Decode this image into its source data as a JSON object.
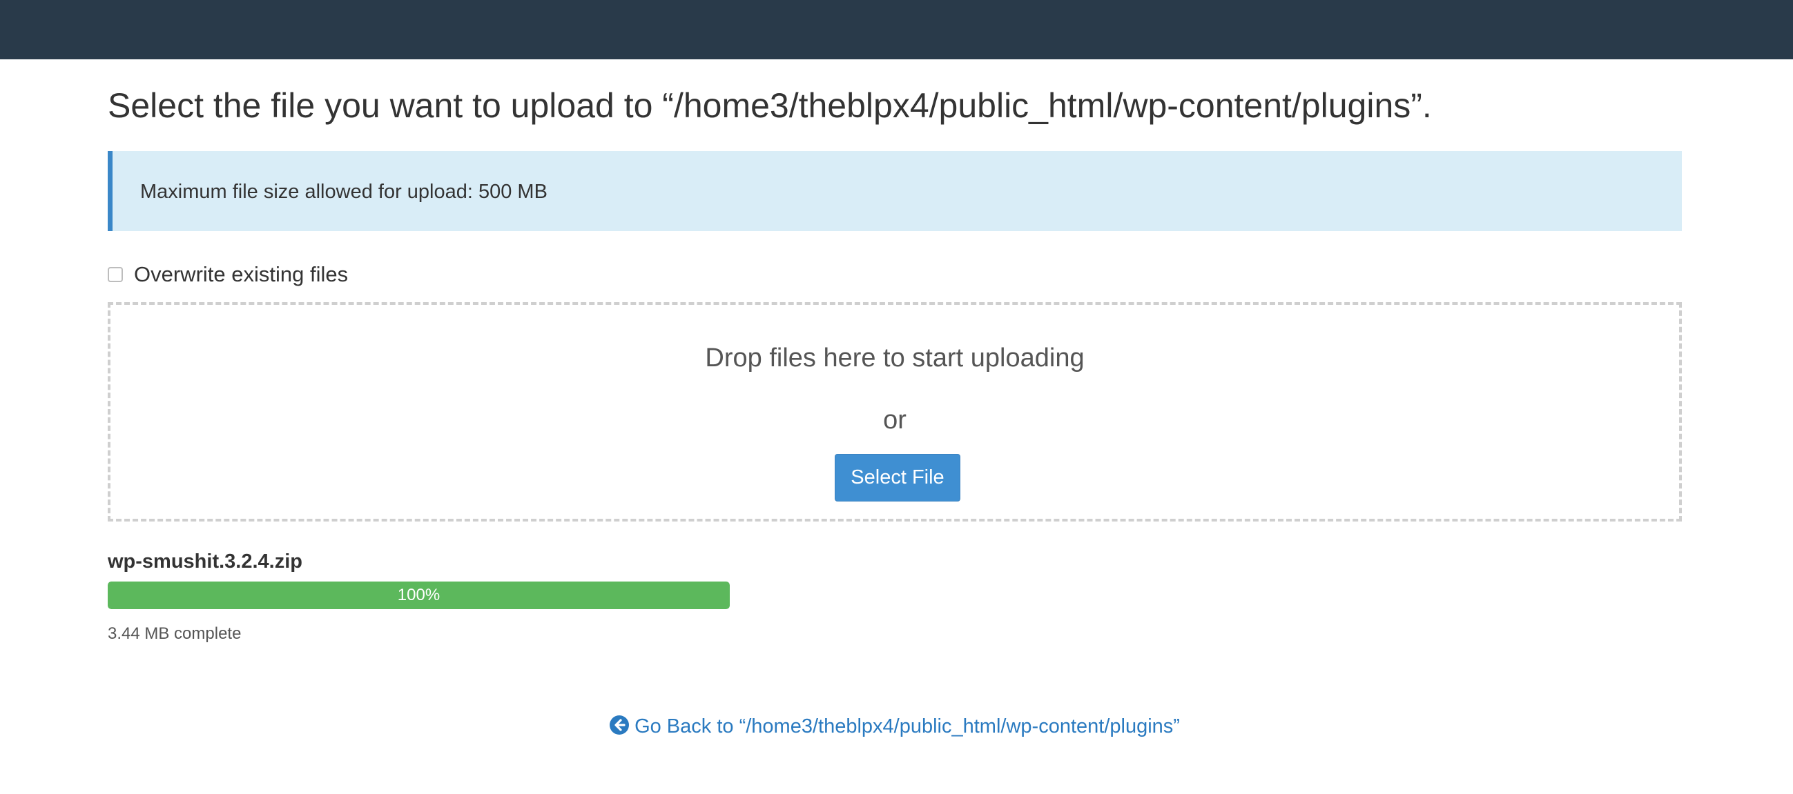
{
  "page": {
    "title": "Select the file you want to upload to “/home3/theblpx4/public_html/wp-content/plugins”."
  },
  "info": {
    "text": "Maximum file size allowed for upload: 500 MB"
  },
  "overwrite": {
    "label": "Overwrite existing files",
    "checked": false
  },
  "dropzone": {
    "drop_text": "Drop files here to start uploading",
    "or_text": "or",
    "select_label": "Select File"
  },
  "upload": {
    "file_name": "wp-smushit.3.2.4.zip",
    "progress_label": "100%",
    "progress_fraction": 1.0,
    "complete_text": "3.44 MB complete"
  },
  "back": {
    "label": "Go Back to “/home3/theblpx4/public_html/wp-content/plugins”",
    "icon": "circle-arrow-left-icon"
  },
  "colors": {
    "topbar": "#293a4a",
    "info_bg": "#d9edf7",
    "info_border": "#3a87c8",
    "button": "#3f8fd2",
    "progress": "#5cb85c",
    "link": "#2a7ac0"
  }
}
